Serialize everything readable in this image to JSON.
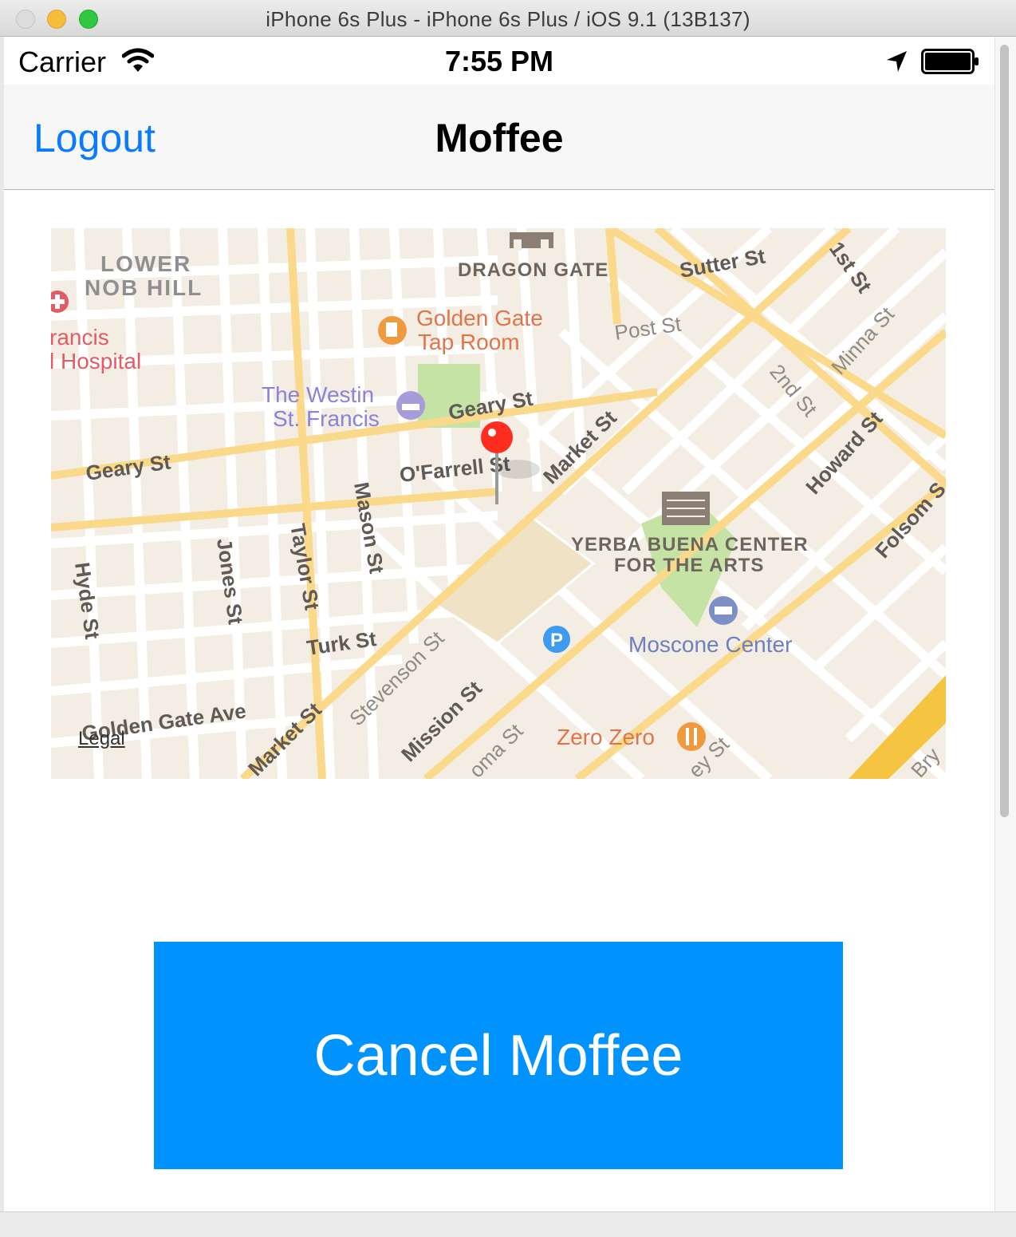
{
  "window": {
    "title": "iPhone 6s Plus - iPhone 6s Plus / iOS 9.1 (13B137)"
  },
  "status_bar": {
    "carrier": "Carrier",
    "time": "7:55 PM"
  },
  "nav": {
    "left_button": "Logout",
    "title": "Moffee"
  },
  "map": {
    "legal": "Legal",
    "labels": {
      "lower_nob_hill_1": "LOWER",
      "lower_nob_hill_2": "NOB HILL",
      "dragon_gate": "DRAGON GATE",
      "golden_gate_1": "Golden Gate",
      "golden_gate_2": "Tap Room",
      "hospital_1": "rancis",
      "hospital_2": "l Hospital",
      "westin_1": "The Westin",
      "westin_2": "St. Francis",
      "ybca_1": "YERBA BUENA CENTER",
      "ybca_2": "FOR THE ARTS",
      "moscone": "Moscone Center",
      "zero_zero": "Zero Zero"
    },
    "streets": {
      "sutter": "Sutter St",
      "first": "1st St",
      "post": "Post St",
      "minna": "Minna St",
      "second": "2nd St",
      "geary_upper": "Geary St",
      "geary_left": "Geary St",
      "ofarrell": "O'Farrell St",
      "market_upper": "Market St",
      "howard": "Howard St",
      "folsom": "Folsom S",
      "mason": "Mason St",
      "taylor": "Taylor St",
      "jones": "Jones St",
      "hyde": "Hyde St",
      "turk": "Turk St",
      "stevenson": "Stevenson St",
      "mission": "Mission St",
      "golden_gate_ave": "Golden Gate Ave",
      "market_lower": "Market St",
      "oma": "oma St",
      "ey": "ey St",
      "bry": "Bry"
    }
  },
  "actions": {
    "cancel": "Cancel Moffee"
  },
  "colors": {
    "accent": "#0a7afe",
    "button": "#0093fe",
    "map_background": "#f3ede3",
    "major_road": "#fbd98a",
    "freeway": "#f5c542",
    "park": "#c5e3a5",
    "pin": "#ff2d20"
  }
}
